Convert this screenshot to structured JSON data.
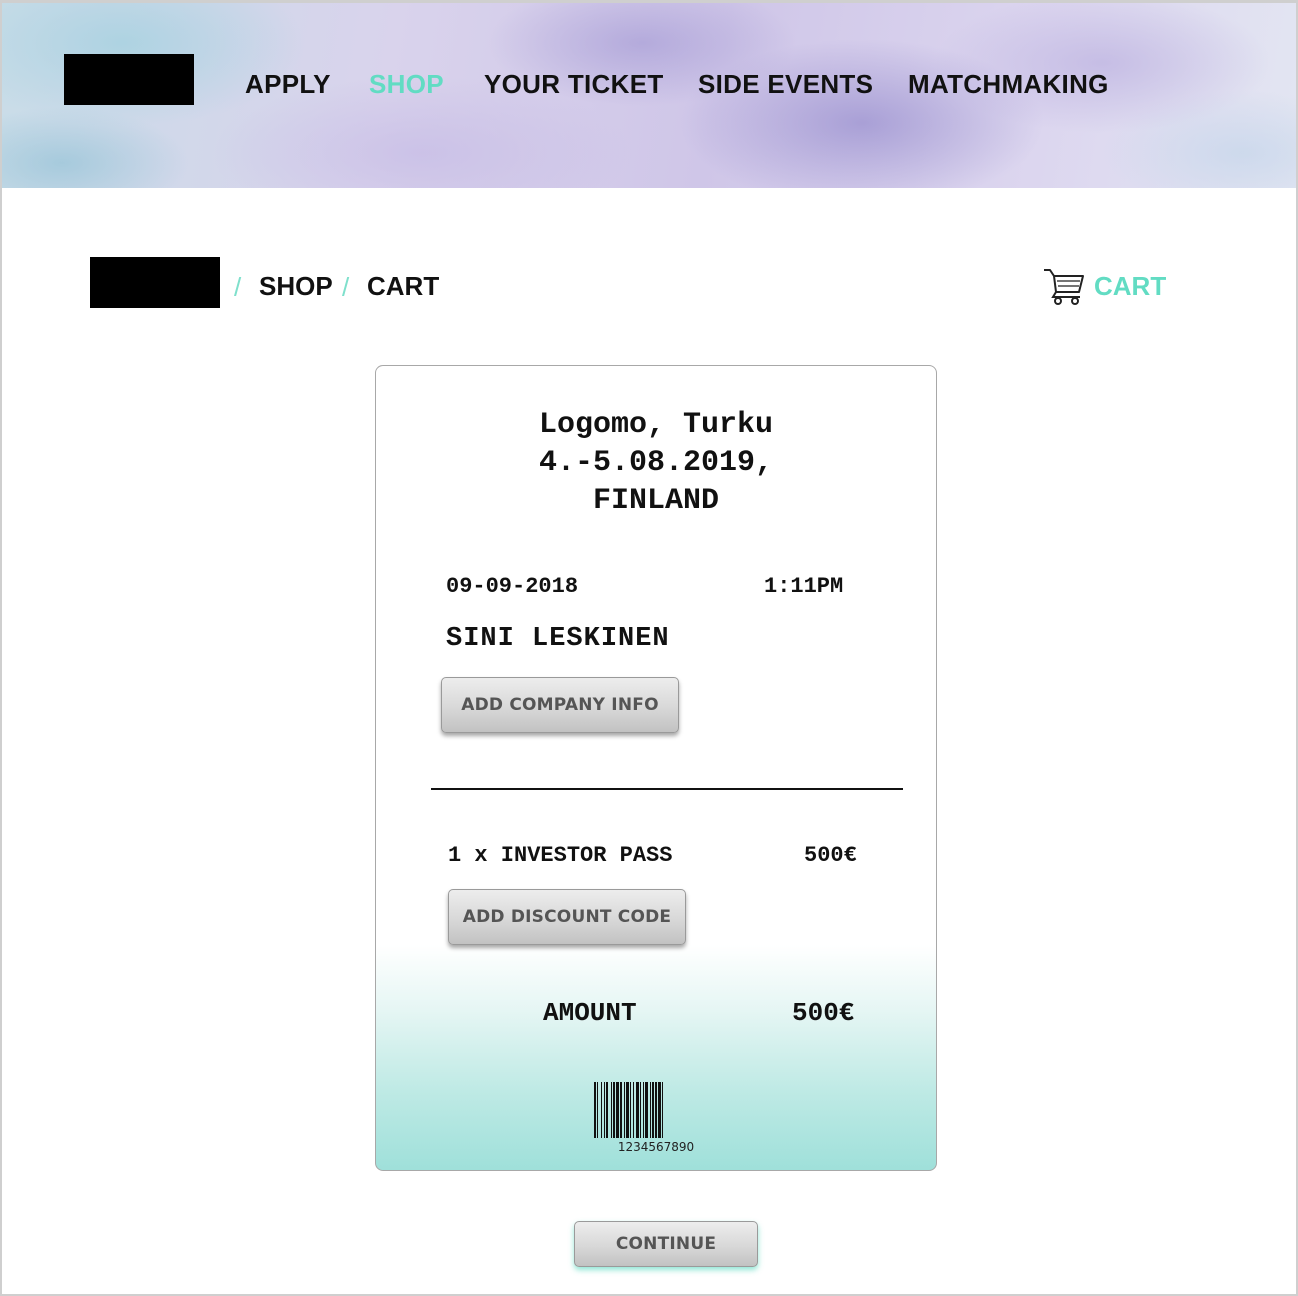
{
  "nav": {
    "items": [
      {
        "label": "APPLY",
        "active": false
      },
      {
        "label": "SHOP",
        "active": true
      },
      {
        "label": "YOUR TICKET",
        "active": false
      },
      {
        "label": "SIDE EVENTS",
        "active": false
      },
      {
        "label": "MATCHMAKING",
        "active": false
      }
    ]
  },
  "breadcrumb": {
    "separator": "/",
    "items": [
      "SHOP",
      "CART"
    ]
  },
  "cart": {
    "icon": "cart-icon",
    "label": "CART"
  },
  "receipt": {
    "venue_line1": "Logomo, Turku",
    "venue_line2": "4.-5.08.2019,",
    "venue_line3": "FINLAND",
    "date": "09-09-2018",
    "time": "1:11PM",
    "name": "SINI LESKINEN",
    "add_company_label": "ADD COMPANY INFO",
    "item_label": "1 x INVESTOR PASS",
    "item_price": "500€",
    "add_discount_label": "ADD DISCOUNT CODE",
    "amount_label": "AMOUNT",
    "amount_value": "500€",
    "barcode_number": "1234567890"
  },
  "continue_label": "CONTINUE",
  "colors": {
    "accent": "#62dcc3",
    "text": "#111111",
    "button": "#d8d8d8"
  }
}
